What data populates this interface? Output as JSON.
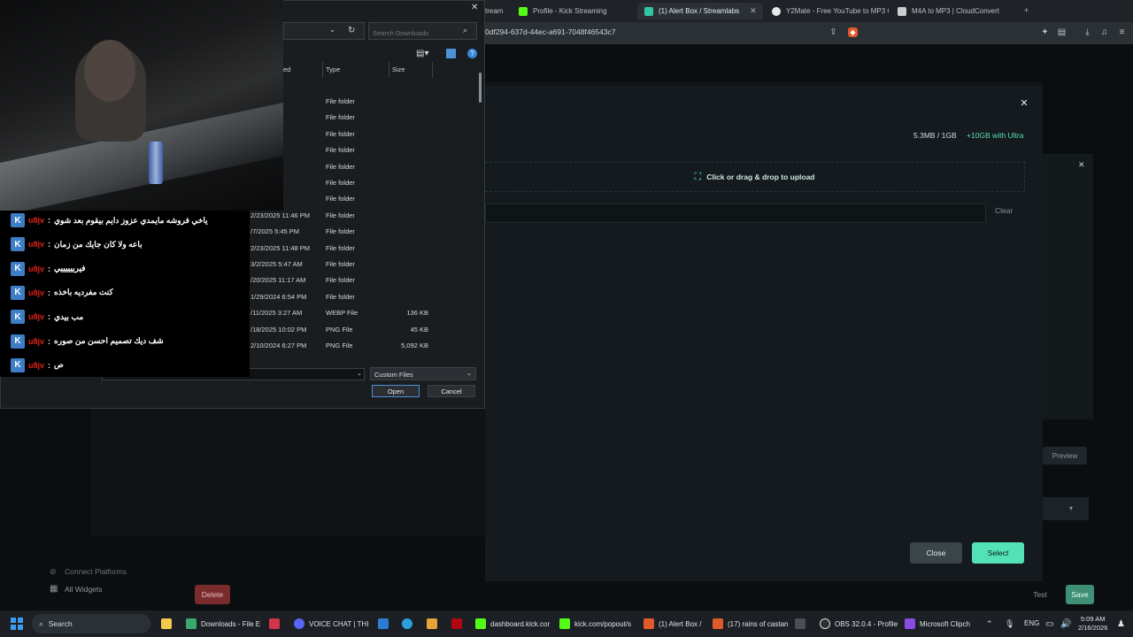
{
  "browser": {
    "tabs": [
      {
        "label": "tream",
        "icon": "kick-icon"
      },
      {
        "label": "Profile - Kick Streaming",
        "icon": "kick-icon"
      },
      {
        "label": "(1) Alert Box / Streamlabs",
        "icon": "streamlabs-icon"
      },
      {
        "label": "Y2Mate - Free YouTube to MP3 C",
        "icon": "y2mate-icon"
      },
      {
        "label": "M4A to MP3 | CloudConvert",
        "icon": "cloudconvert-icon"
      }
    ],
    "url": "0df294-637d-44ec-a691-7048f46543c7"
  },
  "modal": {
    "storage_used": "5.3MB / 1GB",
    "storage_upgrade": "+10GB with Ultra",
    "dropzone_label": "Click or drag & drop to upload",
    "clear_label": "Clear",
    "close_label": "Close",
    "select_label": "Select",
    "accent": "#53e2b6"
  },
  "page": {
    "preview_label": "Preview",
    "connect_platforms": "Connect Platforms",
    "all_widgets": "All Widgets",
    "delete_label": "Delete",
    "test_label": "Test",
    "save_label": "Save"
  },
  "file_dialog": {
    "search_placeholder": "Search Downloads",
    "columns": {
      "modified": "ed",
      "type": "Type",
      "size": "Size"
    },
    "rows": [
      {
        "modified": "38 AM",
        "type": "File folder",
        "size": ""
      },
      {
        "modified": "53 AM",
        "type": "File folder",
        "size": ""
      },
      {
        "modified": "36 AM",
        "type": "File folder",
        "size": ""
      },
      {
        "modified": "38 AM",
        "type": "File folder",
        "size": ""
      },
      {
        "modified": ":40 AM",
        "type": "File folder",
        "size": ""
      },
      {
        "modified": "0:43 PM",
        "type": "File folder",
        "size": ""
      },
      {
        "modified": "54 AM",
        "type": "File folder",
        "size": ""
      },
      {
        "modified": "2/23/2025 11:46 PM",
        "type": "File folder",
        "size": ""
      },
      {
        "modified": "/7/2025 5:45 PM",
        "type": "File folder",
        "size": ""
      },
      {
        "modified": "2/23/2025 11:48 PM",
        "type": "File folder",
        "size": ""
      },
      {
        "modified": "3/2/2025 5:47 AM",
        "type": "File folder",
        "size": ""
      },
      {
        "modified": "/20/2025 11:17 AM",
        "type": "File folder",
        "size": ""
      },
      {
        "modified": "1/29/2024 6:54 PM",
        "type": "File folder",
        "size": ""
      },
      {
        "modified": "/11/2025 3:27 AM",
        "type": "WEBP File",
        "size": "136 KB"
      },
      {
        "modified": "/18/2025 10:02 PM",
        "type": "PNG File",
        "size": "45 KB"
      },
      {
        "modified": "2/10/2024 6:27 PM",
        "type": "PNG File",
        "size": "5,092 KB"
      }
    ],
    "file_type": "Custom Files",
    "open_label": "Open",
    "cancel_label": "Cancel"
  },
  "chat": {
    "messages": [
      {
        "user": "u8jv",
        "text": "ياخي فروشه مايمدي عزوز دايم بيقوم بعد شوي"
      },
      {
        "user": "u8jv",
        "text": "باعه ولا كان جايك من زمان"
      },
      {
        "user": "u8jv",
        "text": "فيرييييييي"
      },
      {
        "user": "u8jv",
        "text": "كنت مفرديه باخذه"
      },
      {
        "user": "u8jv",
        "text": "مب بيدي"
      },
      {
        "user": "u8jv",
        "text": "شف ديك تصميم احسن من صوره"
      },
      {
        "user": "u8jv",
        "text": "ص"
      }
    ]
  },
  "taskbar": {
    "search_label": "Search",
    "items": [
      {
        "label": "Downloads - File E"
      },
      {
        "label": "VOICE CHAT | THI"
      },
      {
        "label": "dashboard.kick.cor"
      },
      {
        "label": "kick.com/popout/s"
      },
      {
        "label": "(1) Alert Box /"
      },
      {
        "label": "(17) rains of castam"
      },
      {
        "label": "OBS 32.0.4 - Profile"
      },
      {
        "label": "Microsoft Clipch"
      }
    ],
    "language": "ENG",
    "time": "5:09 AM",
    "date": "2/16/2026"
  }
}
